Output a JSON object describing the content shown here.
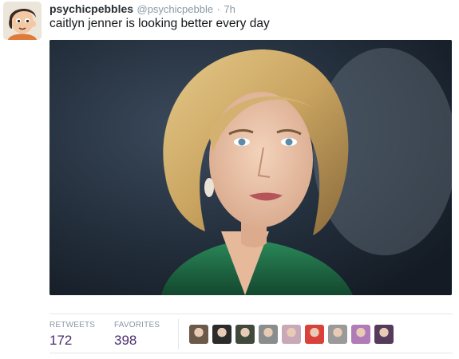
{
  "tweet": {
    "display_name": "psychicpebbles",
    "handle": "@psychicpebble",
    "separator": "·",
    "timestamp": "7h",
    "text": "caitlyn jenner is looking better every day"
  },
  "stats": {
    "retweets_label": "RETWEETS",
    "retweets_count": "172",
    "favorites_label": "FAVORITES",
    "favorites_count": "398"
  },
  "favoriter_avatars": [
    {
      "color": "#6b5a4a"
    },
    {
      "color": "#2b2b2b"
    },
    {
      "color": "#3f4a3c"
    },
    {
      "color": "#8a8d8e"
    },
    {
      "color": "#c9a9b8"
    },
    {
      "color": "#d9413a"
    },
    {
      "color": "#9a9a9a"
    },
    {
      "color": "#b17ab8"
    },
    {
      "color": "#553a5c"
    }
  ],
  "colors": {
    "stat_value": "#4a2d6e",
    "muted": "#8899a6",
    "photo_background": "#1e2a38",
    "photo_hair": "#c9a460",
    "photo_dress": "#1f6b45"
  }
}
